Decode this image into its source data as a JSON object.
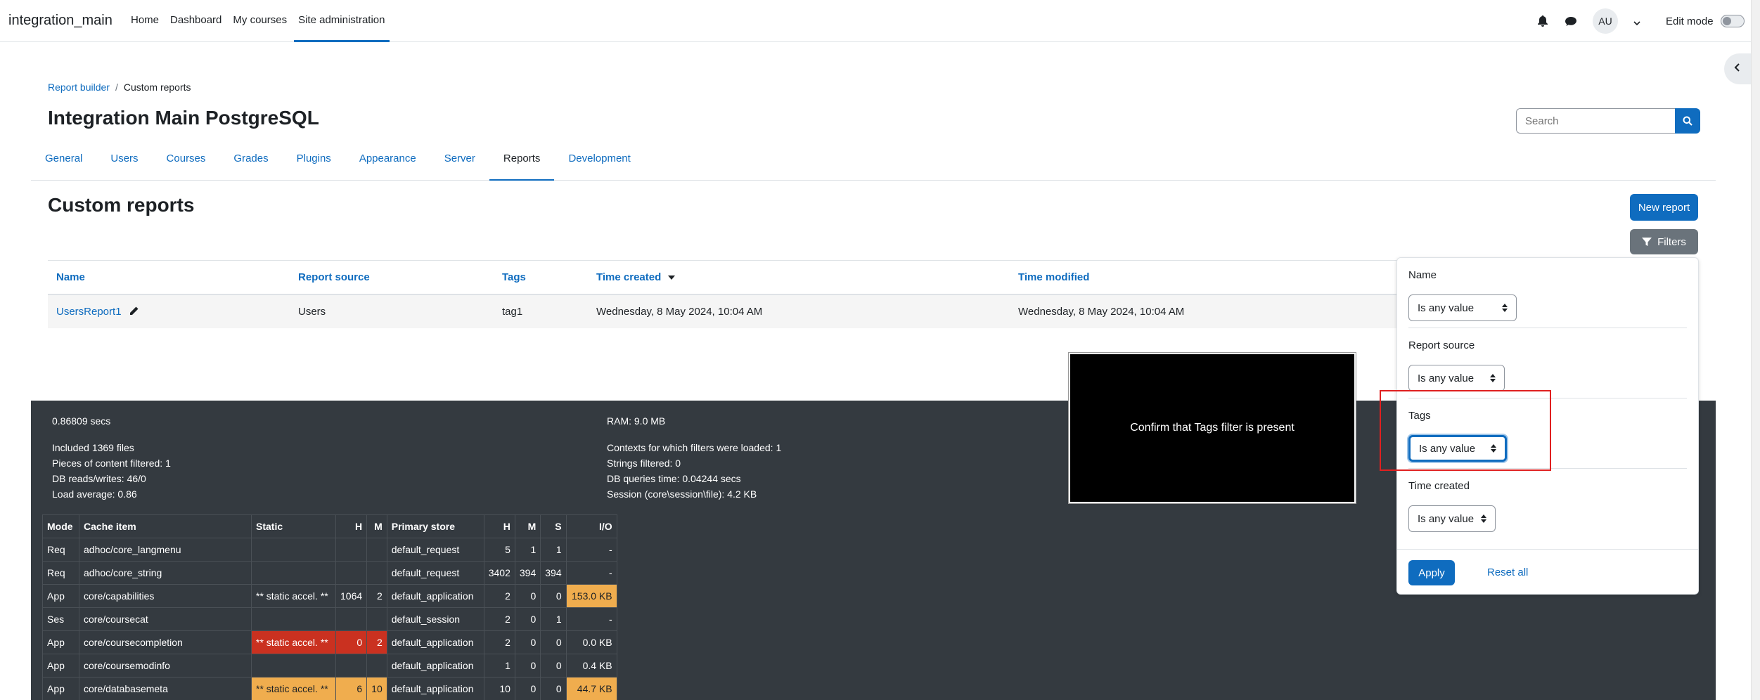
{
  "navbar": {
    "brand": "integration_main",
    "items": [
      "Home",
      "Dashboard",
      "My courses",
      "Site administration"
    ],
    "avatar": "AU",
    "edit_mode": "Edit mode"
  },
  "breadcrumb": {
    "item1": "Report builder",
    "sep": "/",
    "item2": "Custom reports"
  },
  "page_title": "Integration Main PostgreSQL",
  "search": {
    "placeholder": "Search"
  },
  "secondary_nav": [
    "General",
    "Users",
    "Courses",
    "Grades",
    "Plugins",
    "Appearance",
    "Server",
    "Reports",
    "Development"
  ],
  "section_title": "Custom reports",
  "buttons": {
    "new_report": "New report",
    "filters": "Filters"
  },
  "table": {
    "headers": [
      "Name",
      "Report source",
      "Tags",
      "Time created",
      "Time modified"
    ],
    "rows": [
      [
        "UsersReport1",
        "Users",
        "tag1",
        "Wednesday, 8 May 2024, 10:04 AM",
        "Wednesday, 8 May 2024, 10:04 AM"
      ]
    ]
  },
  "filters": {
    "name_label": "Name",
    "source_label": "Report source",
    "tags_label": "Tags",
    "time_label": "Time created",
    "any_value": "Is any value",
    "apply": "Apply",
    "reset": "Reset all"
  },
  "footer": {
    "secs": "0.86809 secs",
    "ram": "RAM: 9.0 MB",
    "left": [
      "Included 1369 files",
      "Pieces of content filtered: 1",
      "DB reads/writes: 46/0",
      "Load average: 0.86"
    ],
    "right": [
      "Contexts for which filters were loaded: 1",
      "Strings filtered: 0",
      "DB queries time: 0.04244 secs",
      "Session (core\\session\\file): 4.2 KB"
    ],
    "cache_headers": [
      "Mode",
      "Cache item",
      "Static",
      "H",
      "M",
      "Primary store",
      "H",
      "M",
      "S",
      "I/O"
    ],
    "cache_rows": [
      [
        "Req",
        "adhoc/core_langmenu",
        "",
        "",
        "",
        "default_request",
        "5",
        "1",
        "1",
        "-"
      ],
      [
        "Req",
        "adhoc/core_string",
        "",
        "",
        "",
        "default_request",
        "3402",
        "394",
        "394",
        "-"
      ],
      [
        "App",
        "core/capabilities",
        "** static accel. **",
        "1064",
        "2",
        "default_application",
        "2",
        "0",
        "0",
        "153.0 KB"
      ],
      [
        "Ses",
        "core/coursecat",
        "",
        "",
        "",
        "default_session",
        "2",
        "0",
        "1",
        "-"
      ],
      [
        "App",
        "core/coursecompletion",
        "** static accel. **",
        "0",
        "2",
        "default_application",
        "2",
        "0",
        "0",
        "0.0 KB"
      ],
      [
        "App",
        "core/coursemodinfo",
        "",
        "",
        "",
        "default_application",
        "1",
        "0",
        "0",
        "0.4 KB"
      ],
      [
        "App",
        "core/databasemeta",
        "** static accel. **",
        "6",
        "10",
        "default_application",
        "10",
        "0",
        "0",
        "44.7 KB"
      ]
    ]
  },
  "overlay_text": "Confirm that Tags filter is present"
}
